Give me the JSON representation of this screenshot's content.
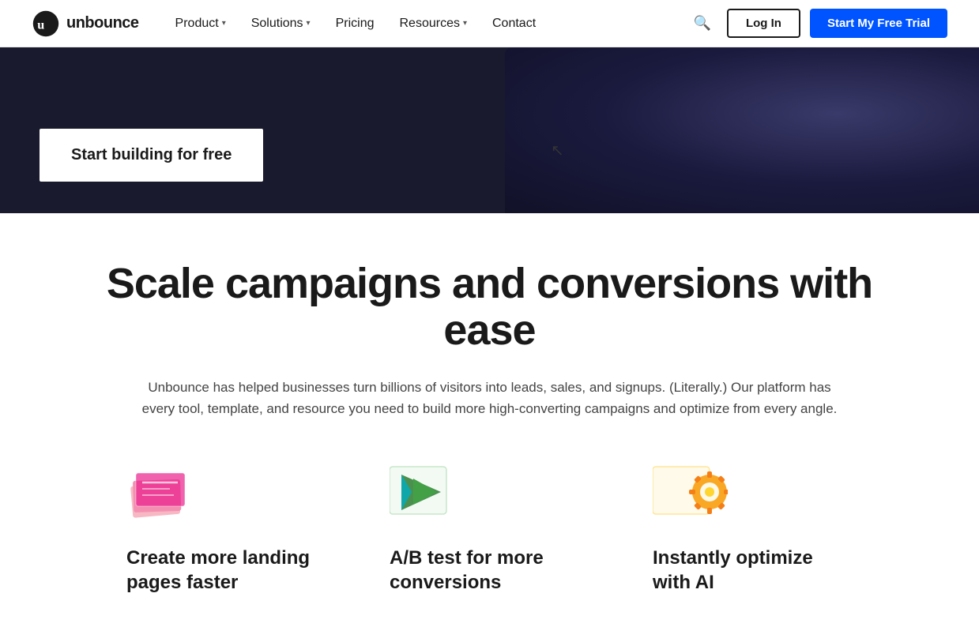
{
  "navbar": {
    "logo_text": "unbounce",
    "nav_items": [
      {
        "label": "Product",
        "has_chevron": true
      },
      {
        "label": "Solutions",
        "has_chevron": true
      },
      {
        "label": "Pricing",
        "has_chevron": false
      },
      {
        "label": "Resources",
        "has_chevron": true
      },
      {
        "label": "Contact",
        "has_chevron": false
      }
    ],
    "login_label": "Log In",
    "trial_label": "Start My Free Trial"
  },
  "hero": {
    "cta_label": "Start building for free"
  },
  "scale_section": {
    "title": "Scale campaigns and conversions with ease",
    "subtitle": "Unbounce has helped businesses turn billions of visitors into leads, sales, and signups. (Literally.) Our platform has every tool, template, and resource you need to build more high-converting campaigns and optimize from every angle."
  },
  "features": [
    {
      "id": "landing-pages",
      "title": "Create more landing pages faster",
      "icon": "layers-icon"
    },
    {
      "id": "ab-test",
      "title": "A/B test for more conversions",
      "icon": "ab-test-icon"
    },
    {
      "id": "ai-optimize",
      "title": "Instantly optimize with AI",
      "icon": "ai-icon"
    }
  ]
}
